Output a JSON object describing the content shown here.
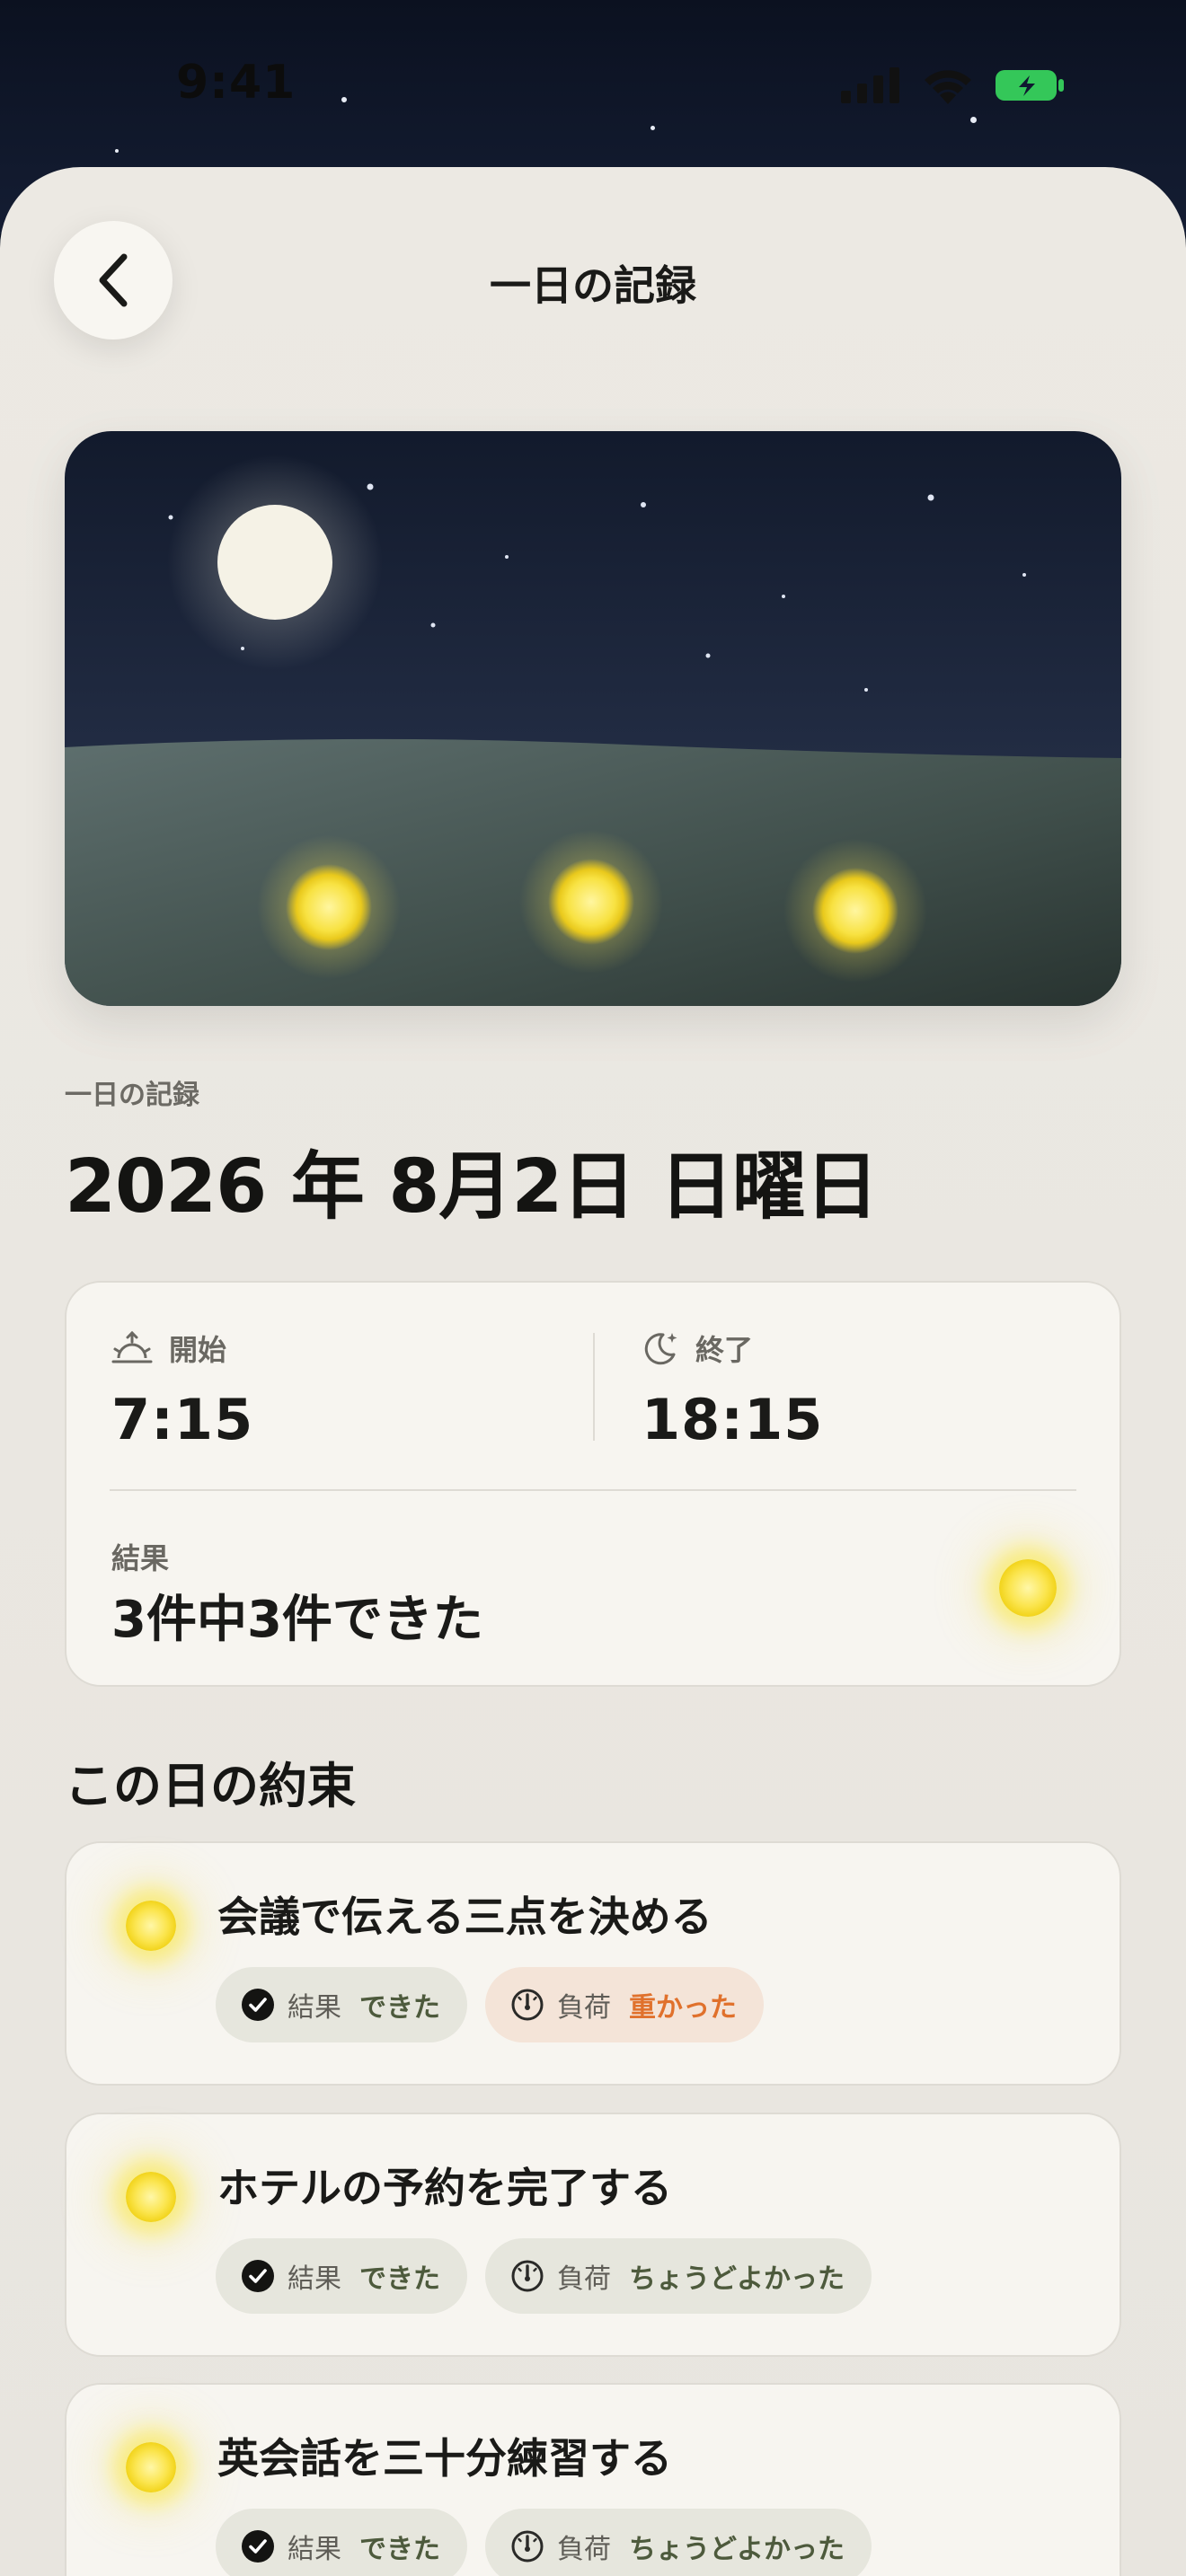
{
  "status_bar": {
    "time": "9:41"
  },
  "nav": {
    "title": "一日の記録"
  },
  "header": {
    "eyebrow": "一日の記録",
    "date": "2026 年 8月2日 日曜日"
  },
  "summary": {
    "start_label": "開始",
    "start_time": "7:15",
    "end_label": "終了",
    "end_time": "18:15",
    "result_label": "結果",
    "result_value": "3件中3件できた"
  },
  "section": {
    "title": "この日の約束"
  },
  "promises": [
    {
      "title": "会議で伝える三点を決める",
      "result_label": "結果",
      "result_value": "できた",
      "load_label": "負荷",
      "load_value": "重かった"
    },
    {
      "title": "ホテルの予約を完了する",
      "result_label": "結果",
      "result_value": "できた",
      "load_label": "負荷",
      "load_value": "ちょうどよかった"
    },
    {
      "title": "英会話を三十分練習する",
      "result_label": "結果",
      "result_value": "できた",
      "load_label": "負荷",
      "load_value": "ちょうどよかった"
    }
  ],
  "colors": {
    "background": "#e9e6e0",
    "card": "#f7f5f0",
    "firefly": "#f6e03a",
    "heavy_accent": "#e0712c",
    "ok_accent": "#4d5a3c",
    "battery": "#34c759"
  },
  "icons": [
    "back-chevron-icon",
    "signal-icon",
    "wifi-icon",
    "battery-icon",
    "sunrise-icon",
    "moon-icon",
    "check-circle-icon",
    "gauge-icon"
  ]
}
